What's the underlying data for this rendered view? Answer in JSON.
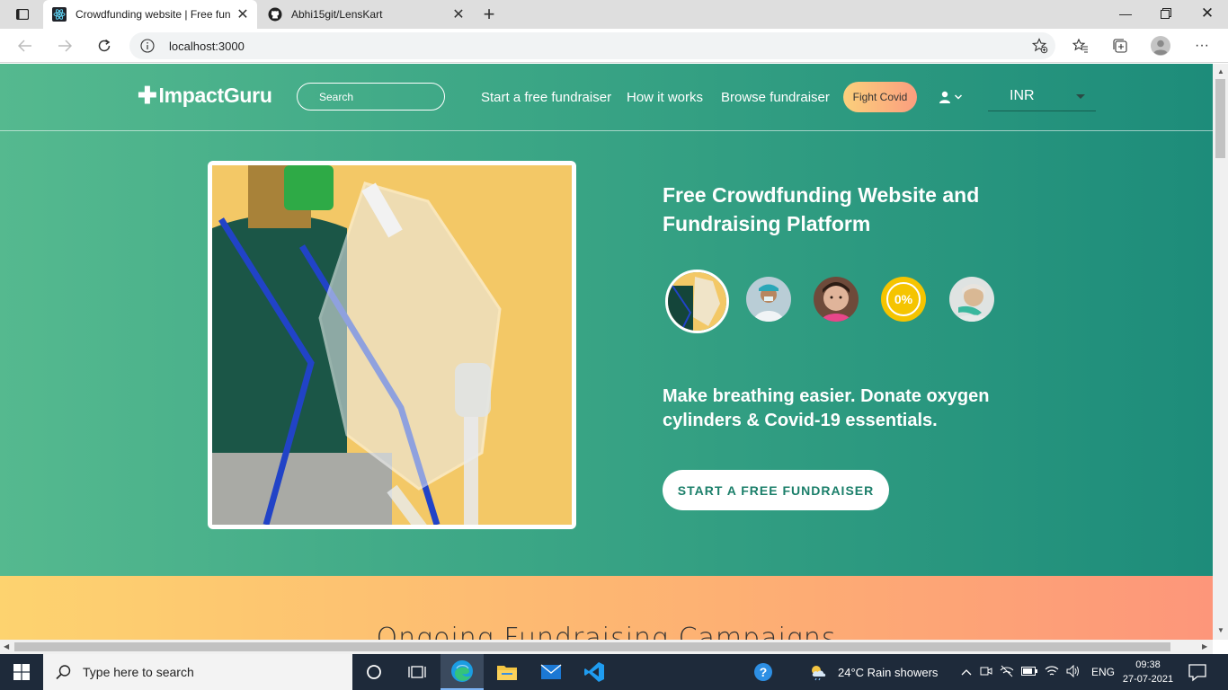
{
  "browser": {
    "tabs": [
      {
        "title": "Crowdfunding website | Free fun",
        "active": true,
        "icon": "react-icon"
      },
      {
        "title": "Abhi15git/LensKart",
        "active": false,
        "icon": "github-icon"
      }
    ],
    "address": "localhost:3000"
  },
  "site": {
    "logo": "ImpactGuru",
    "search_placeholder": "Search",
    "nav": {
      "start_fundraiser": "Start a free fundraiser",
      "how_it_works": "How it works",
      "browse_fundraiser": "Browse fundraiser"
    },
    "fight_covid": "Fight Covid",
    "currency": "INR",
    "hero": {
      "title": "Free Crowdfunding Website and Fundraising Platform",
      "subtitle": "Make breathing easier. Donate oxygen cylinders & Covid-19 essentials.",
      "cta": "START A FREE FUNDRAISER",
      "thumb_badge": "0%"
    },
    "section_heading": "Ongoing Fundraising Campaigns"
  },
  "taskbar": {
    "search_placeholder": "Type here to search",
    "weather": "24°C  Rain showers",
    "language": "ENG",
    "time": "09:38",
    "date": "27-07-2021"
  },
  "colors": {
    "hero_start": "#55b98f",
    "hero_end": "#1d8c7a",
    "cta_text": "#1b7f6a",
    "band_start": "#fdd36f",
    "band_end": "#fd967a"
  }
}
